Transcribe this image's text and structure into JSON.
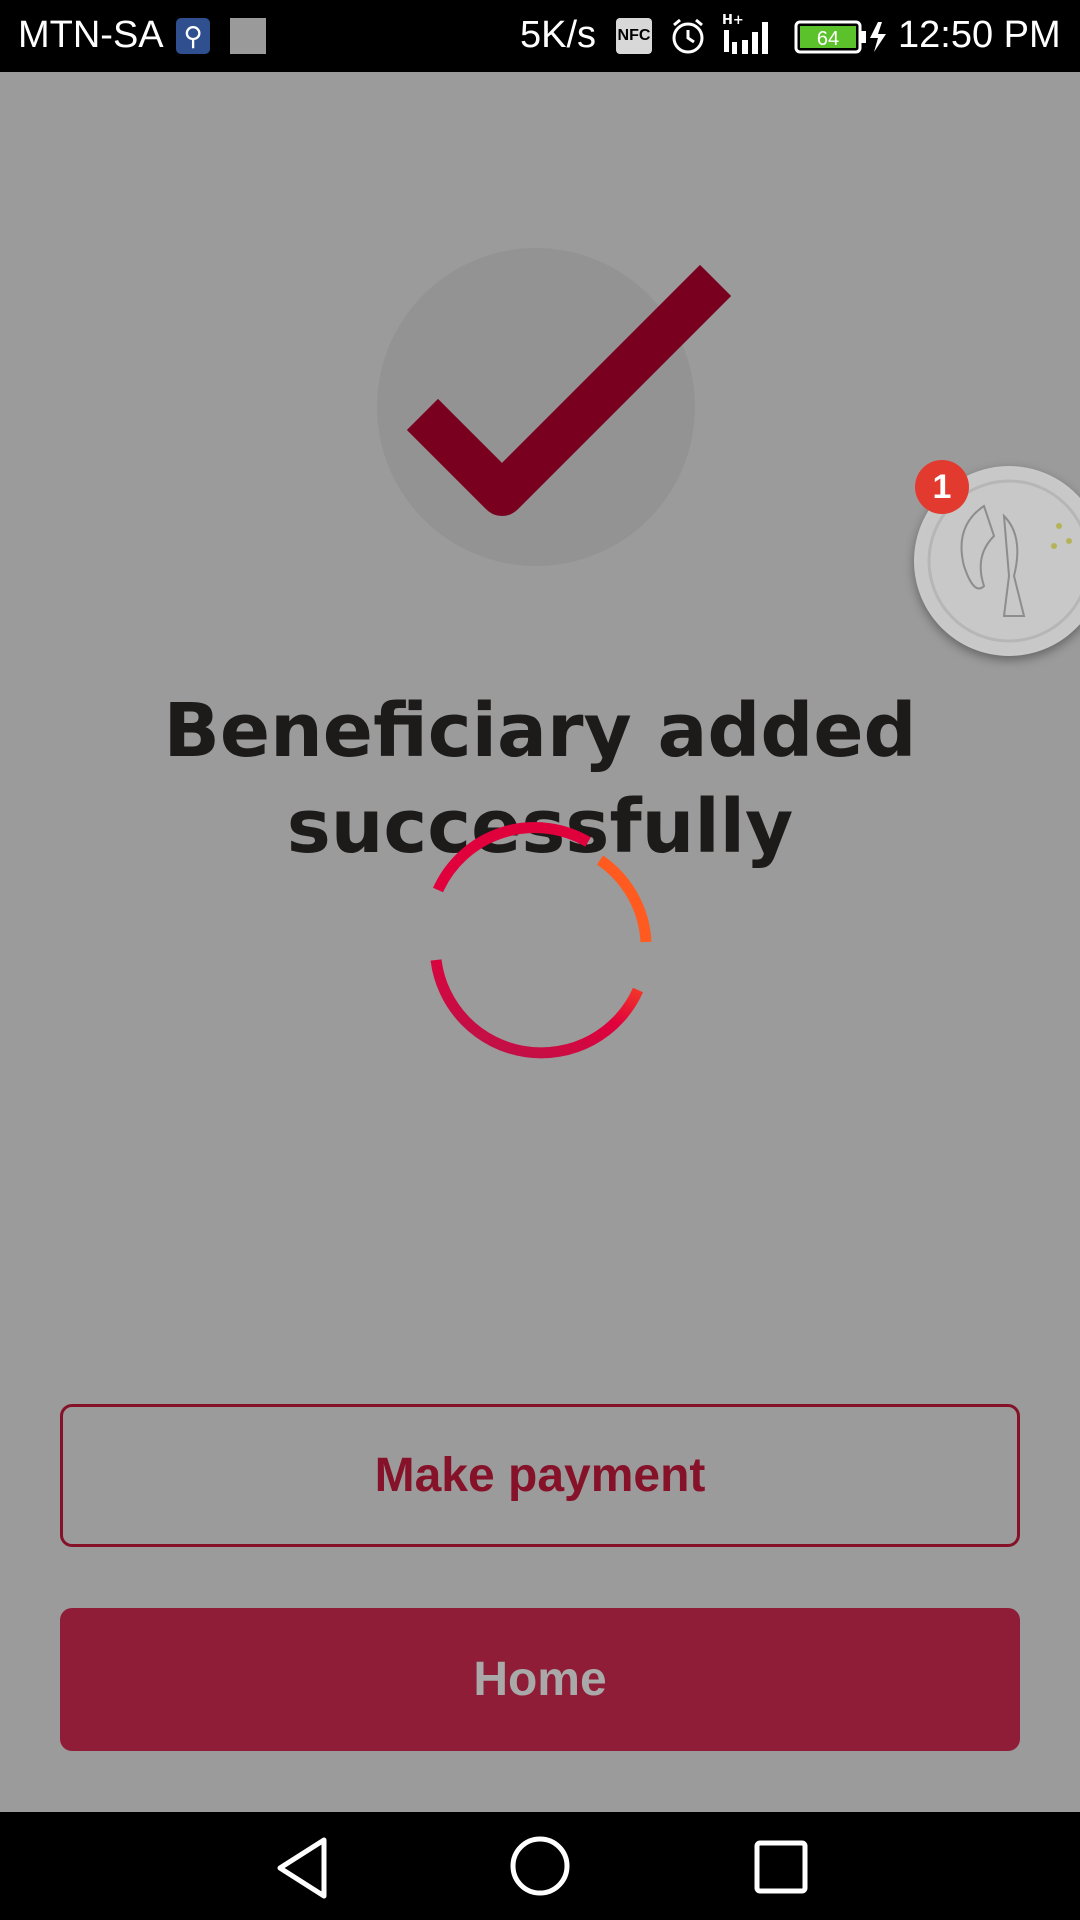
{
  "status_bar": {
    "carrier": "MTN-SA",
    "network_speed": "5K/s",
    "nfc_label": "NFC",
    "battery_level": "64",
    "time": "12:50 PM",
    "icons": [
      "usb-icon",
      "notification-thumbnail-icon",
      "nfc-icon",
      "alarm-icon",
      "signal-icon",
      "battery-icon",
      "charging-icon"
    ]
  },
  "success": {
    "icon": "checkmark-icon",
    "title": "Beneficiary added successfully"
  },
  "loading": {
    "icon": "loading-spinner-icon"
  },
  "chat_head": {
    "badge_count": "1"
  },
  "actions": {
    "make_payment_label": "Make payment",
    "home_label": "Home"
  },
  "colors": {
    "overlay": "#9b9b9b",
    "brand": "#86122a",
    "brand_fill": "#8f1d37",
    "spinner_start": "#e0003c",
    "spinner_end": "#ff5a1f",
    "badge": "#e23a2e"
  },
  "nav_bar": {
    "icons": [
      "back-icon",
      "home-icon",
      "recent-apps-icon"
    ]
  }
}
